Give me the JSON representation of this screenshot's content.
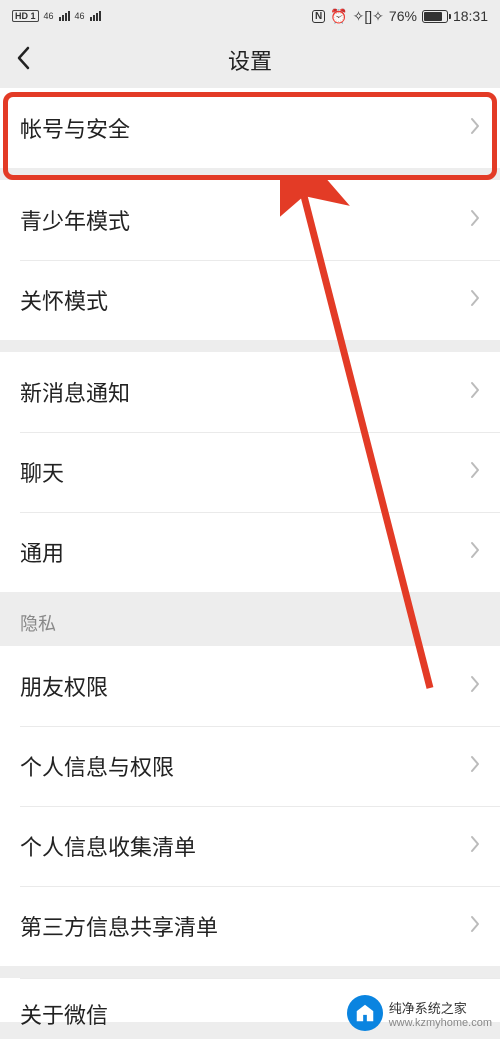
{
  "status": {
    "hd": "HD",
    "sim1": "1",
    "sig_sup": "46",
    "battery_pct": "76%",
    "time": "18:31"
  },
  "nav": {
    "title": "设置"
  },
  "groups": [
    {
      "items": [
        {
          "label": "帐号与安全"
        }
      ]
    },
    {
      "items": [
        {
          "label": "青少年模式"
        },
        {
          "label": "关怀模式"
        }
      ]
    },
    {
      "items": [
        {
          "label": "新消息通知"
        },
        {
          "label": "聊天"
        },
        {
          "label": "通用"
        }
      ]
    }
  ],
  "privacy": {
    "header": "隐私",
    "items": [
      {
        "label": "朋友权限"
      },
      {
        "label": "个人信息与权限"
      },
      {
        "label": "个人信息收集清单"
      },
      {
        "label": "第三方信息共享清单"
      }
    ]
  },
  "cutoff": {
    "label": "关于微信"
  },
  "annotation": {
    "highlight_color": "#e33b26"
  },
  "watermark": {
    "name": "纯净系统之家",
    "url": "www.kzmyhome.com"
  }
}
